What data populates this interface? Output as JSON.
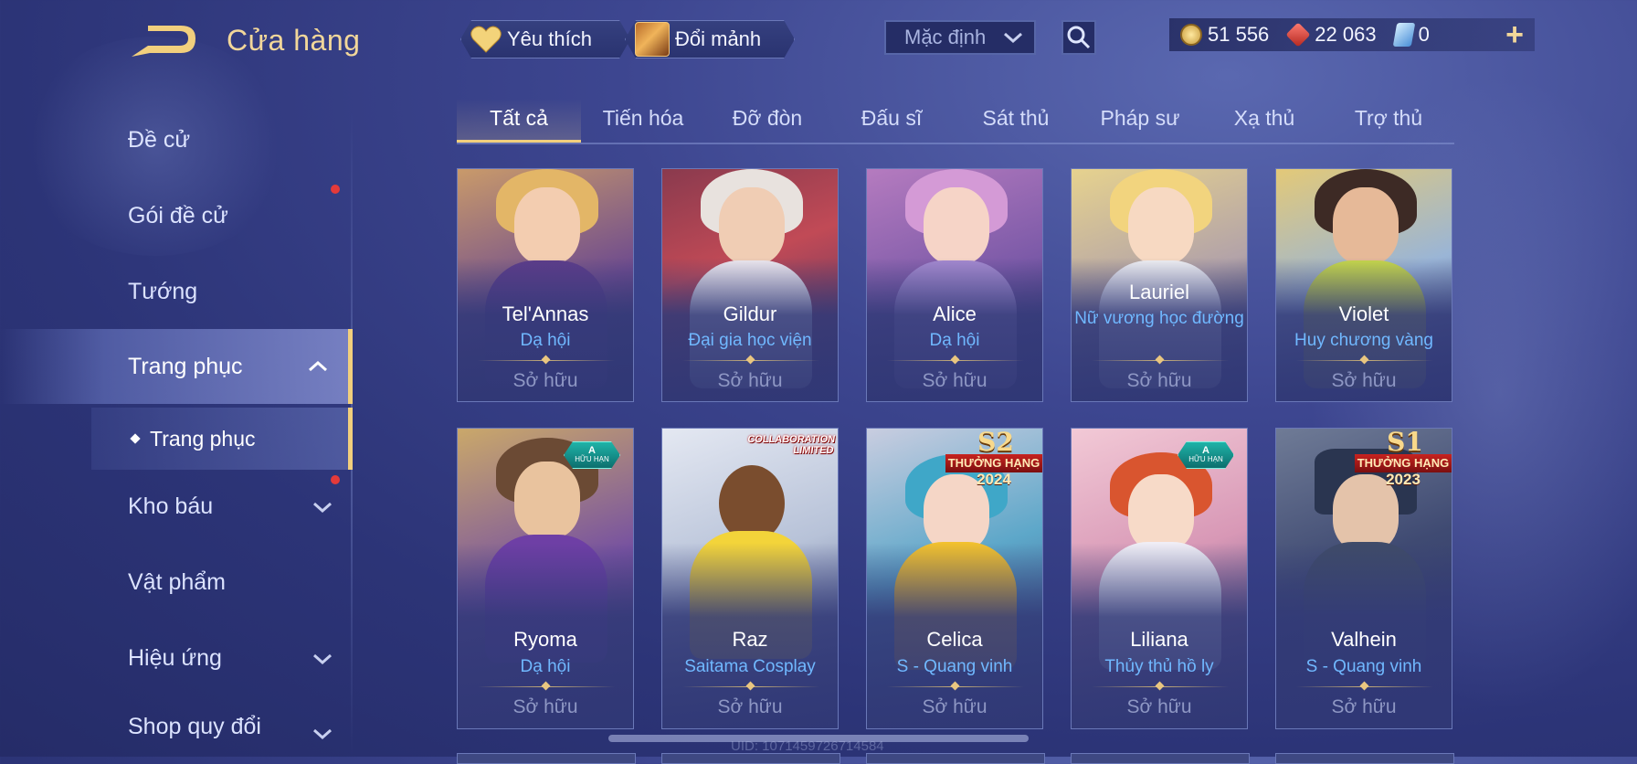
{
  "header": {
    "title": "Cửa hàng",
    "favorites_label": "Yêu thích",
    "shard_exchange_label": "Đổi mảnh",
    "sort_value": "Mặc định"
  },
  "currencies": {
    "gold": "51 556",
    "gems": "22 063",
    "vouchers": "0",
    "add_symbol": "+"
  },
  "sidebar": {
    "items": [
      {
        "label": "Đề cử"
      },
      {
        "label": "Gói đề cử"
      },
      {
        "label": "Tướng"
      },
      {
        "label": "Trang phục"
      },
      {
        "label": "Kho báu"
      },
      {
        "label": "Vật phẩm"
      },
      {
        "label": "Hiệu ứng"
      },
      {
        "label": "Shop quy đổi"
      }
    ],
    "sub_item": "Trang phục"
  },
  "tabs": [
    "Tất cả",
    "Tiến hóa",
    "Đỡ đòn",
    "Đấu sĩ",
    "Sát thủ",
    "Pháp sư",
    "Xạ thủ",
    "Trợ thủ"
  ],
  "cards": [
    {
      "hero": "Tel'Annas",
      "skin": "Dạ hội",
      "status": "Sở hữu"
    },
    {
      "hero": "Gildur",
      "skin": "Đại gia học viện",
      "status": "Sở hữu"
    },
    {
      "hero": "Alice",
      "skin": "Dạ hội",
      "status": "Sở hữu"
    },
    {
      "hero": "Lauriel",
      "skin": "Nữ vương học đường",
      "status": "Sở hữu"
    },
    {
      "hero": "Violet",
      "skin": "Huy chương vàng",
      "status": "Sở hữu"
    },
    {
      "hero": "Ryoma",
      "skin": "Dạ hội",
      "status": "Sở hữu",
      "badge_top": "A",
      "badge_bottom": "HỮU HẠN"
    },
    {
      "hero": "Raz",
      "skin": "Saitama Cosplay",
      "status": "Sở hữu",
      "badge_line1": "COLLABORATION",
      "badge_line2": "LIMITED"
    },
    {
      "hero": "Celica",
      "skin": "S - Quang vinh",
      "status": "Sở hữu",
      "badge_season": "S2",
      "badge_text": "THƯỞNG HẠNG",
      "badge_year": "2024"
    },
    {
      "hero": "Liliana",
      "skin": "Thủy thủ hồ ly",
      "status": "Sở hữu",
      "badge_top": "A",
      "badge_bottom": "HỮU HẠN"
    },
    {
      "hero": "Valhein",
      "skin": "S - Quang vinh",
      "status": "Sở hữu",
      "badge_season": "S1",
      "badge_text": "THƯỞNG HẠNG",
      "badge_year": "2023"
    }
  ],
  "footer": {
    "uid": "UID: 1071459726714584"
  },
  "colors": {
    "gold_accent": "#f1cf7d",
    "skin_name": "#70b8ff",
    "notification": "#e43a3a"
  }
}
